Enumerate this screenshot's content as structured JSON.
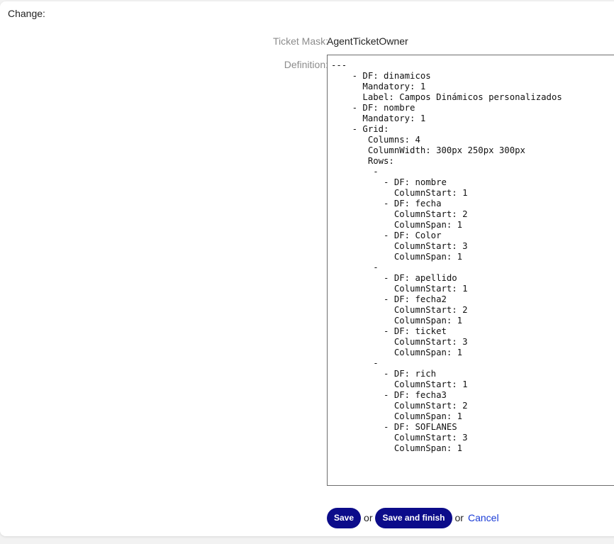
{
  "section": {
    "title": "Change:"
  },
  "form": {
    "ticket_mask_label": "Ticket Mask:",
    "ticket_mask_value": "AgentTicketOwner",
    "definition_label": "Definition:",
    "definition_value": "---\n    - DF: dinamicos\n      Mandatory: 1\n      Label: Campos Dinámicos personalizados\n    - DF: nombre\n      Mandatory: 1\n    - Grid:\n       Columns: 4\n       ColumnWidth: 300px 250px 300px\n       Rows:\n        -\n          - DF: nombre\n            ColumnStart: 1\n          - DF: fecha\n            ColumnStart: 2\n            ColumnSpan: 1\n          - DF: Color\n            ColumnStart: 3\n            ColumnSpan: 1\n        -\n          - DF: apellido\n            ColumnStart: 1\n          - DF: fecha2\n            ColumnStart: 2\n            ColumnSpan: 1\n          - DF: ticket\n            ColumnStart: 3\n            ColumnSpan: 1\n        -\n          - DF: rich\n            ColumnStart: 1\n          - DF: fecha3\n            ColumnStart: 2\n            ColumnSpan: 1\n          - DF: SOFLANES\n            ColumnStart: 3\n            ColumnSpan: 1"
  },
  "actions": {
    "save_label": "Save",
    "or_1": "or",
    "save_finish_label": "Save and finish",
    "or_2": "or",
    "cancel_label": "Cancel"
  },
  "colors": {
    "button_bg": "#0c0c8a",
    "link": "#1a3bd6",
    "label": "#8c8c8c"
  }
}
